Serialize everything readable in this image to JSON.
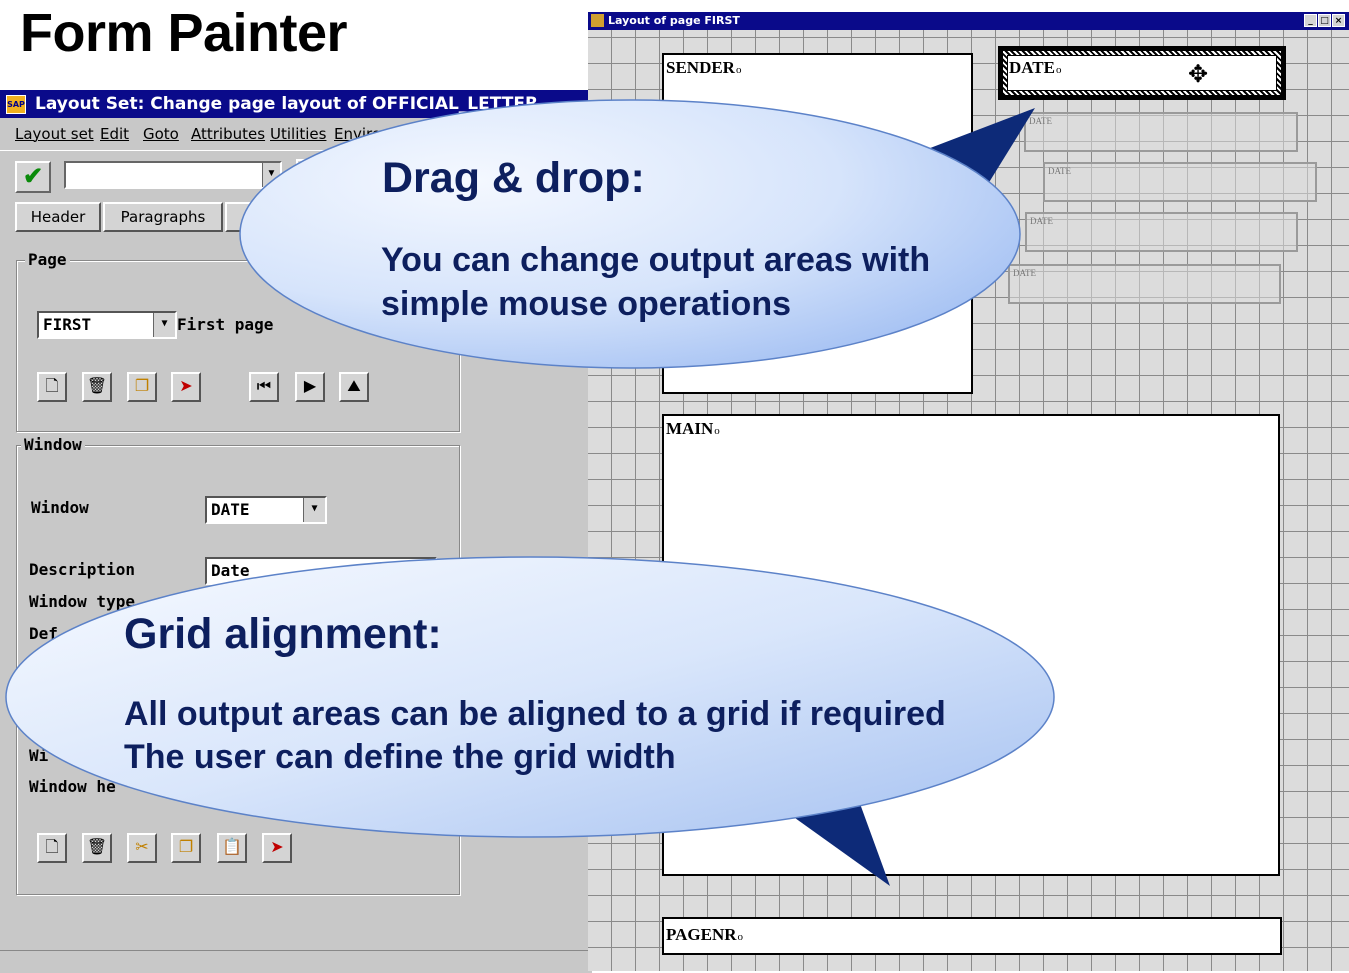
{
  "slide": {
    "title": "Form Painter"
  },
  "sap_window": {
    "title": "Layout Set: Change page layout of OFFICIAL_LETTER",
    "menu": [
      "Layout set",
      "Edit",
      "Goto",
      "Attributes",
      "Utilities",
      "Environ"
    ],
    "tabs": [
      "Header",
      "Paragraphs"
    ],
    "page_group": {
      "label": "Page",
      "page_value": "FIRST",
      "page_description": "First page"
    },
    "window_group": {
      "label": "Window",
      "window_label": "Window",
      "window_value": "DATE",
      "description_label": "Description",
      "description_value": "Date",
      "window_type_label": "Window type",
      "default_label": "Def",
      "window_width_label_partial": "Wi",
      "window_height_label_partial": "Window he"
    }
  },
  "layout_window": {
    "title": "Layout of page FIRST",
    "areas": {
      "sender": "SENDER",
      "date": "DATE",
      "main": "MAIN",
      "pagenr": "PAGENR"
    },
    "ghost_label": "DATE"
  },
  "callouts": {
    "drag": {
      "heading": "Drag & drop:",
      "body": "You can change output areas with simple mouse operations"
    },
    "grid": {
      "heading": "Grid alignment:",
      "line1": "All output areas can be aligned to a grid if required",
      "line2": "The user can define the grid width"
    }
  },
  "colors": {
    "titlebar": "#0a0a8a",
    "callout_text": "#0d1f5e",
    "callout_fill_light": "#f4f8ff",
    "callout_fill_dark": "#9fbdf2"
  }
}
